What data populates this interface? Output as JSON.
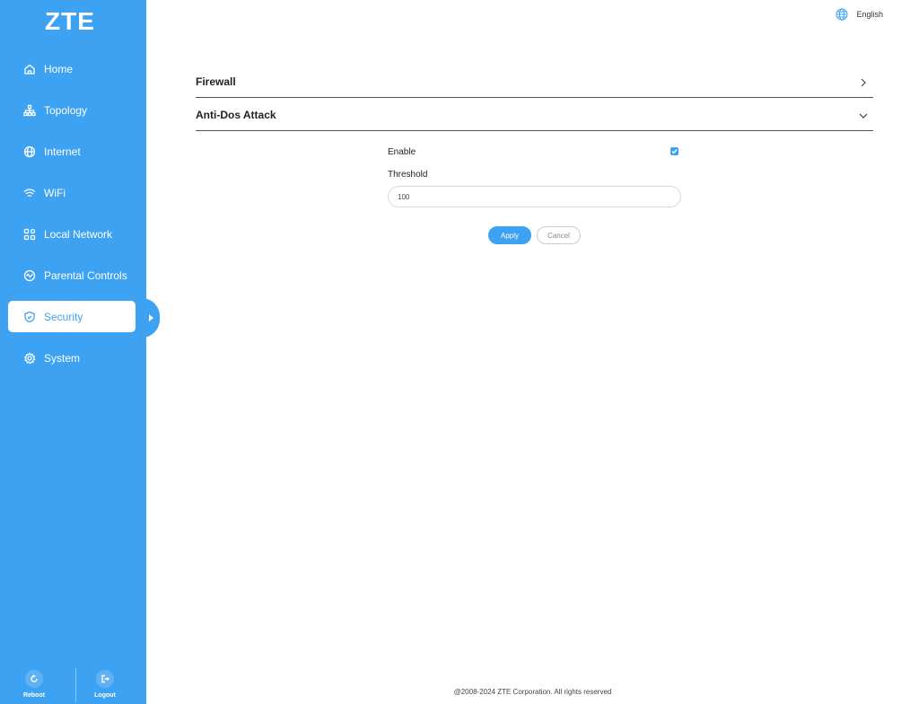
{
  "brand": {
    "logo_text": "ZTE",
    "accent_color": "#3ea2f3"
  },
  "language": {
    "label": "English",
    "icon": "globe-icon"
  },
  "sidebar": {
    "items": [
      {
        "label": "Home",
        "icon": "home-icon"
      },
      {
        "label": "Topology",
        "icon": "topology-icon"
      },
      {
        "label": "Internet",
        "icon": "globe-icon"
      },
      {
        "label": "WiFi",
        "icon": "wifi-icon"
      },
      {
        "label": "Local Network",
        "icon": "grid-icon"
      },
      {
        "label": "Parental Controls",
        "icon": "parental-icon"
      },
      {
        "label": "Security",
        "icon": "shield-icon",
        "active": true
      },
      {
        "label": "System",
        "icon": "gear-icon"
      }
    ],
    "footer": {
      "reboot_label": "Reboot",
      "logout_label": "Logout"
    }
  },
  "sections": {
    "firewall": {
      "title": "Firewall",
      "expanded": false
    },
    "anti_dos": {
      "title": "Anti-Dos Attack",
      "expanded": true,
      "enable_label": "Enable",
      "enable_checked": true,
      "threshold_label": "Threshold",
      "threshold_value": "100"
    }
  },
  "buttons": {
    "apply": "Apply",
    "cancel": "Cancel"
  },
  "footer": {
    "copyright": "@2008-2024 ZTE Corporation. All rights reserved"
  }
}
